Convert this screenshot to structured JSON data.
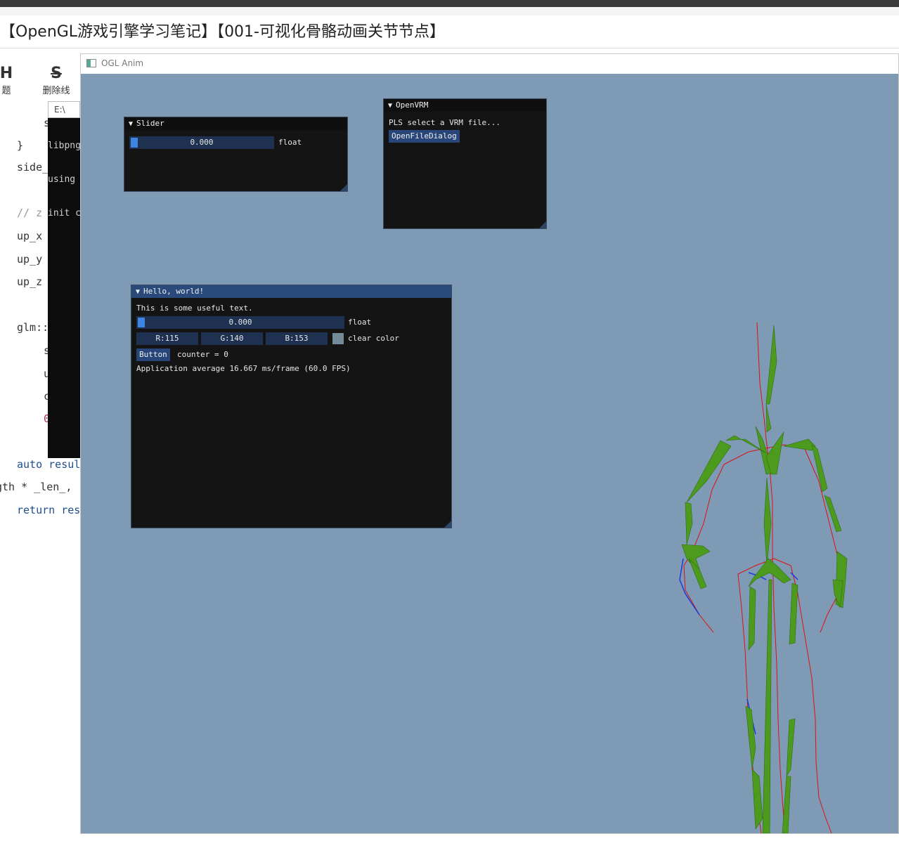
{
  "page": {
    "doc_title": "【OpenGL游戏引擎学习笔记】【001-可视化骨骼动画关节节点】"
  },
  "editor": {
    "toolbar": {
      "heading_glyph": "H",
      "heading_label": "题",
      "strike_glyph": "S",
      "strike_label": "删除线"
    },
    "code_lines": {
      "l1": "s",
      "l2": "}",
      "l3": "side_",
      "l4": "// z",
      "l5": "up_x",
      "l6": "up_y",
      "l7": "up_z",
      "l8": "glm::",
      "l9": "s",
      "l10": "u",
      "l11": "c",
      "l12": "0",
      "l13": "auto resul",
      "l14": "gth * _len_,",
      "l15": "return res"
    }
  },
  "console": {
    "title": "E:\\",
    "line1": "libpng",
    "line2": "using",
    "line3": "init c"
  },
  "app": {
    "title": "OGL Anim",
    "clear_color": "#7e9ab4",
    "slider_window": {
      "title": "Slider",
      "value": "0.000",
      "value_fraction": 0.0,
      "label": "float"
    },
    "openvrm_window": {
      "title": "OpenVRM",
      "prompt": "PLS select a VRM file...",
      "button": "OpenFileDialog"
    },
    "hello_window": {
      "title": "Hello, world!",
      "text": "This is some useful text.",
      "slider_value": "0.000",
      "slider_fraction": 0.0,
      "slider_label": "float",
      "r": "R:115",
      "g": "G:140",
      "b": "B:153",
      "color_label": "clear color",
      "swatch": "#738c99",
      "button": "Button",
      "counter": "counter = 0",
      "fps": "Application average 16.667 ms/frame (60.0 FPS)"
    },
    "skeleton": {
      "bone_color": "#4c9a1e",
      "line_color": "#dd1111",
      "accent_color": "#1a3cdd"
    }
  }
}
